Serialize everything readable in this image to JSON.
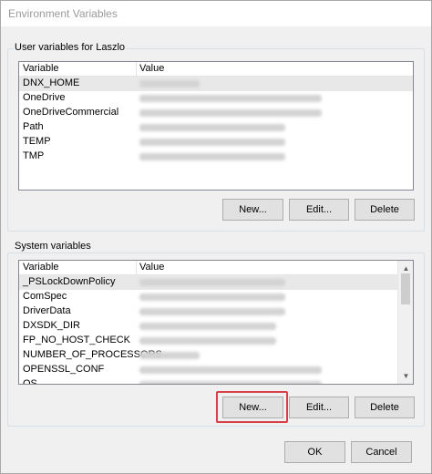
{
  "window": {
    "title": "Environment Variables"
  },
  "user_vars": {
    "group_label": "User variables for Laszlo",
    "columns": [
      "Variable",
      "Value"
    ],
    "rows": [
      {
        "name": "DNX_HOME",
        "selected": true
      },
      {
        "name": "OneDrive"
      },
      {
        "name": "OneDriveCommercial"
      },
      {
        "name": "Path"
      },
      {
        "name": "TEMP"
      },
      {
        "name": "TMP"
      }
    ],
    "buttons": {
      "new": "New...",
      "edit": "Edit...",
      "delete": "Delete"
    }
  },
  "system_vars": {
    "group_label": "System variables",
    "columns": [
      "Variable",
      "Value"
    ],
    "rows": [
      {
        "name": "_PSLockDownPolicy",
        "selected": true
      },
      {
        "name": "ComSpec"
      },
      {
        "name": "DriverData"
      },
      {
        "name": "DXSDK_DIR"
      },
      {
        "name": "FP_NO_HOST_CHECK"
      },
      {
        "name": "NUMBER_OF_PROCESSORS"
      },
      {
        "name": "OPENSSL_CONF"
      },
      {
        "name": "OS"
      }
    ],
    "buttons": {
      "new": "New...",
      "edit": "Edit...",
      "delete": "Delete"
    }
  },
  "footer": {
    "ok": "OK",
    "cancel": "Cancel"
  },
  "colors": {
    "highlight": "#d9414a"
  }
}
